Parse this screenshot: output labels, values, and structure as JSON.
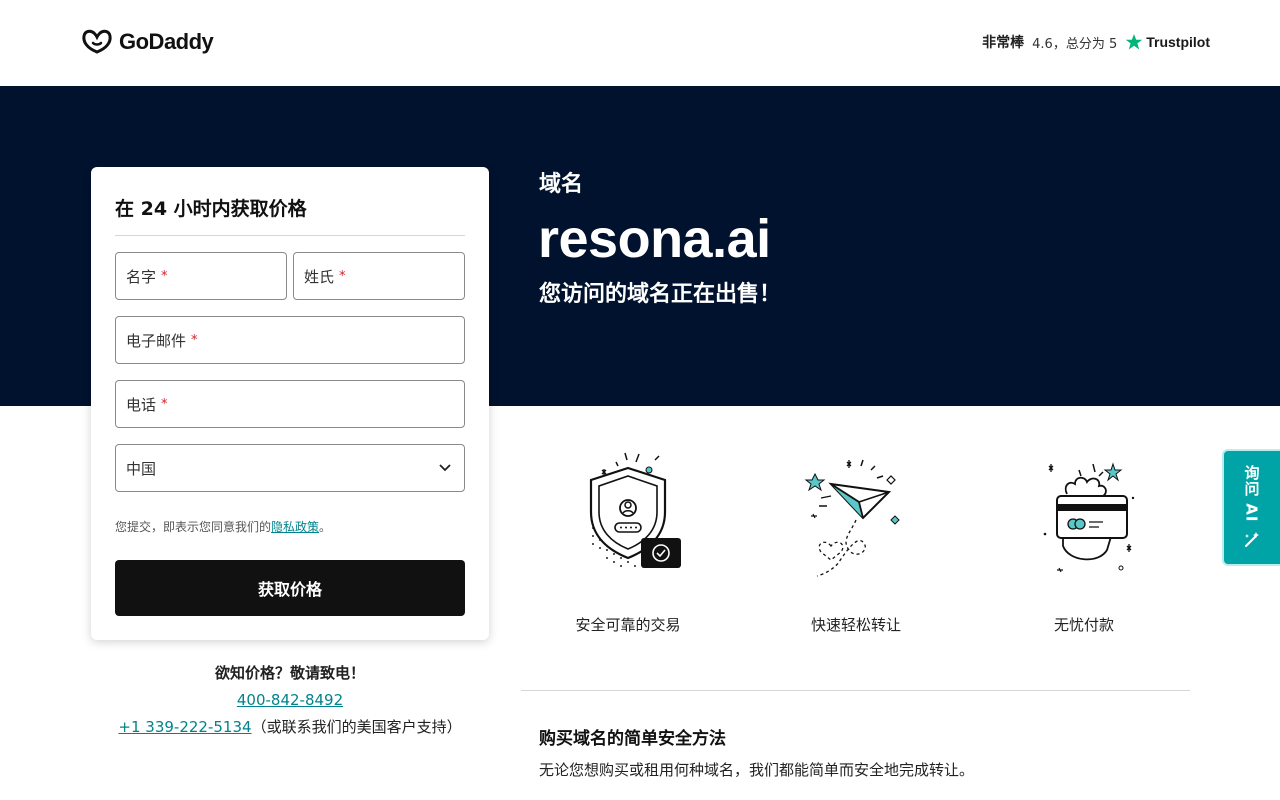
{
  "header": {
    "logo_text": "GoDaddy",
    "rating_word": "非常棒",
    "rating_text": "4.6，总分为 5",
    "trustpilot": "Trustpilot"
  },
  "hero": {
    "kicker": "域名",
    "domain": "resona.ai",
    "subtitle": "您访问的域名正在出售！"
  },
  "form": {
    "title": "在 24 小时内获取价格",
    "first_name": "名字",
    "last_name": "姓氏",
    "email": "电子邮件",
    "phone": "电话",
    "required_mark": "*",
    "country": "中国",
    "consent_prefix": "您提交，即表示您同意我们的",
    "privacy_link": "隐私政策",
    "consent_suffix": "。",
    "submit": "获取价格"
  },
  "contact": {
    "question": "欲知价格？敬请致电！",
    "phone_cn": "400-842-8492",
    "phone_us": "+1 339-222-5134",
    "us_note": "（或联系我们的美国客户支持）"
  },
  "features": [
    {
      "label": "安全可靠的交易",
      "icon": "shield-icon"
    },
    {
      "label": "快速轻松转让",
      "icon": "paper-plane-icon"
    },
    {
      "label": "无忧付款",
      "icon": "card-payment-icon"
    }
  ],
  "bottom": {
    "title": "购买域名的简单安全方法",
    "text": "无论您想购买或租用何种域名，我们都能简单而安全地完成转让。"
  },
  "ai_tab": {
    "label": "询问 AI"
  },
  "colors": {
    "hero_bg": "#00122e",
    "accent": "#00a4a6",
    "link": "#00838c",
    "cta_bg": "#111111"
  }
}
